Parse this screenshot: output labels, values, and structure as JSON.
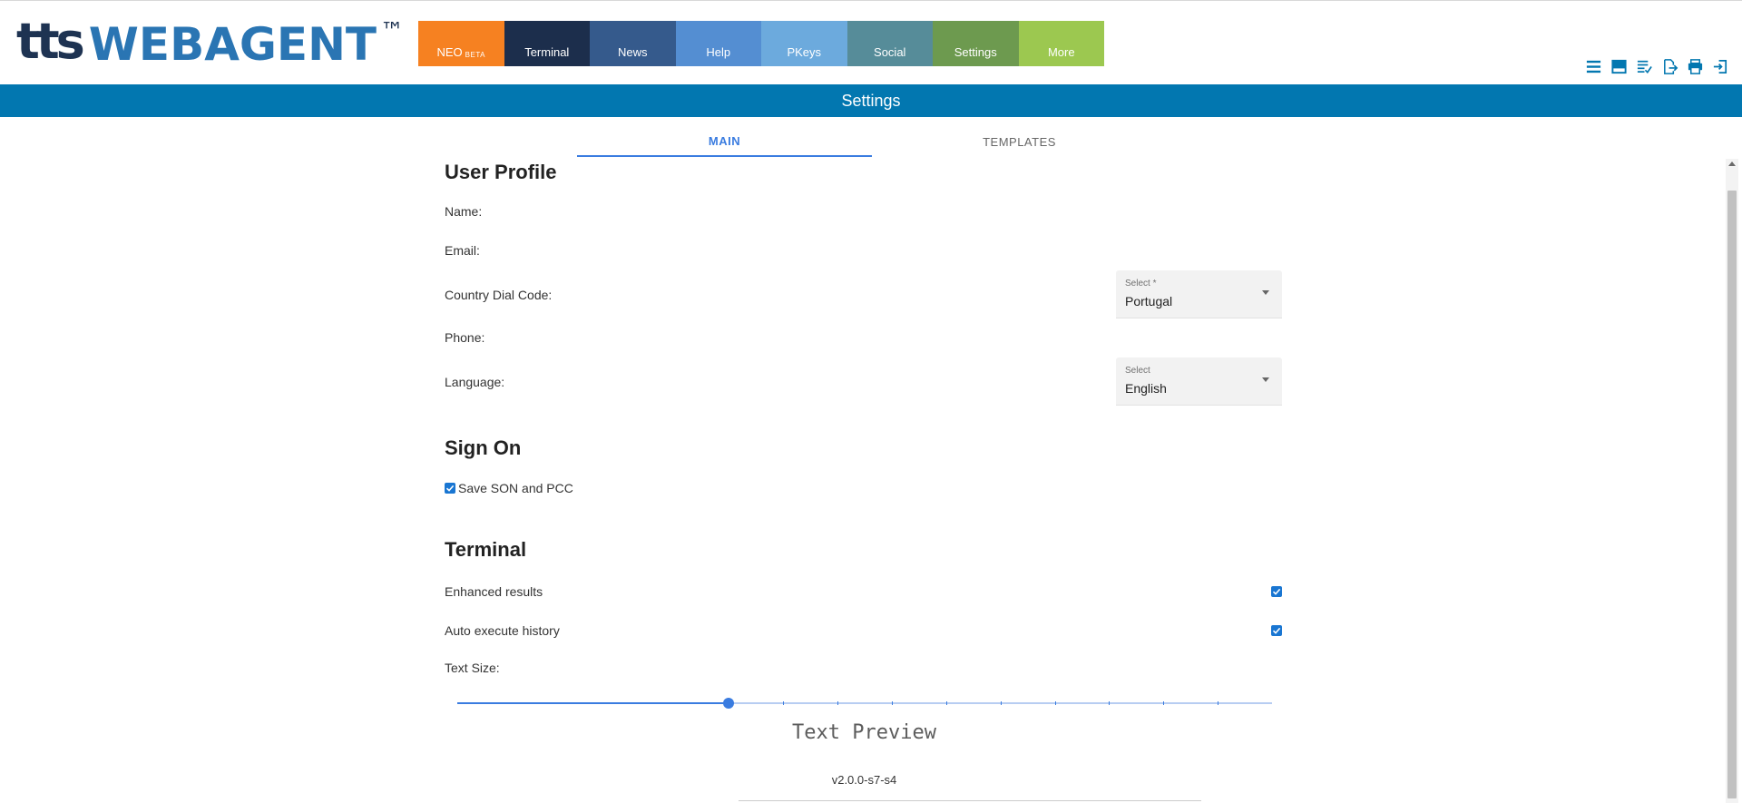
{
  "logo": {
    "tts": "tts",
    "webagent": "WEBAGENT",
    "tm": "™"
  },
  "nav": {
    "tabs": [
      {
        "label": "NEO",
        "badge": "BETA",
        "color": "#f68121"
      },
      {
        "label": "Terminal",
        "color": "#1c2e4c"
      },
      {
        "label": "News",
        "color": "#355a8c"
      },
      {
        "label": "Help",
        "color": "#548ed2"
      },
      {
        "label": "PKeys",
        "color": "#6caadd"
      },
      {
        "label": "Social",
        "color": "#568c99"
      },
      {
        "label": "Settings",
        "color": "#6d9a4f"
      },
      {
        "label": "More",
        "color": "#9cc850"
      }
    ]
  },
  "toolbar": {
    "icons": [
      "menu-icon",
      "panel-icon",
      "list-check-icon",
      "export-icon",
      "print-icon",
      "logout-icon"
    ],
    "color": "#0277b0"
  },
  "page_title": "Settings",
  "subtabs": [
    {
      "label": "MAIN",
      "active": true
    },
    {
      "label": "TEMPLATES",
      "active": false
    }
  ],
  "user_profile": {
    "title": "User Profile",
    "name_label": "Name:",
    "email_label": "Email:",
    "dial_label": "Country Dial Code:",
    "dial_select": {
      "label": "Select *",
      "value": "Portugal"
    },
    "phone_label": "Phone:",
    "language_label": "Language:",
    "language_select": {
      "label": "Select",
      "value": "English"
    }
  },
  "sign_on": {
    "title": "Sign On",
    "save_son_label": "Save SON and PCC",
    "save_son_checked": true
  },
  "terminal": {
    "title": "Terminal",
    "enhanced_label": "Enhanced results",
    "enhanced_checked": true,
    "auto_exec_label": "Auto execute history",
    "auto_exec_checked": true,
    "text_size_label": "Text Size:",
    "text_size": {
      "value": 5,
      "min": 0,
      "max": 15
    }
  },
  "preview_text": "Text Preview",
  "version": "v2.0.0-s7-s4"
}
